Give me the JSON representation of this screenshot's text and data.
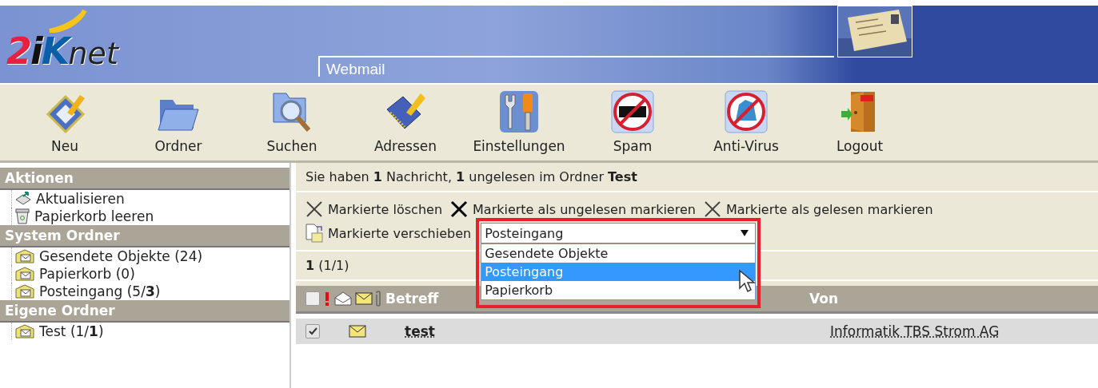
{
  "header": {
    "logo": [
      {
        "text": "2",
        "color": "#e8203f"
      },
      {
        "text": "i",
        "color": "#111111"
      },
      {
        "text": "K",
        "color": "#0a5fa8"
      },
      {
        "text": "net",
        "color": "#222222"
      }
    ],
    "tab": "Webmail"
  },
  "toolbar": [
    {
      "label": "Neu",
      "kind": "new"
    },
    {
      "label": "Ordner",
      "kind": "folder"
    },
    {
      "label": "Suchen",
      "kind": "search"
    },
    {
      "label": "Adressen",
      "kind": "addresses"
    },
    {
      "label": "Einstellungen",
      "kind": "settings"
    },
    {
      "label": "Spam",
      "kind": "spam"
    },
    {
      "label": "Anti-Virus",
      "kind": "antivirus"
    },
    {
      "label": "Logout",
      "kind": "logout"
    }
  ],
  "sidebar": [
    {
      "title": "Aktionen",
      "items": [
        {
          "label": "Aktualisieren",
          "kind": "refresh"
        },
        {
          "label": "Papierkorb leeren",
          "kind": "trash"
        }
      ]
    },
    {
      "title": "System Ordner",
      "items": [
        {
          "label": "Gesendete Objekte (24)",
          "kind": "folder"
        },
        {
          "label": "Papierkorb (0)",
          "kind": "folder"
        },
        {
          "label": "Posteingang (5/**3**)",
          "kind": "folder"
        }
      ]
    },
    {
      "title": "Eigene Ordner",
      "items": [
        {
          "label": "Test (1/**1**)",
          "kind": "folder"
        }
      ]
    }
  ],
  "info": "Sie haben **1** Nachricht, **1** ungelesen im Ordner **Test**",
  "actions": [
    {
      "label": "Markierte löschen",
      "kind": "cross-light"
    },
    {
      "label": "Markierte als ungelesen markieren",
      "kind": "cross-dark"
    },
    {
      "label": "Markierte als gelesen markieren",
      "kind": "cross-light"
    }
  ],
  "move": {
    "label": "Markierte verschieben",
    "value": "Posteingang",
    "options": [
      {
        "label": "Gesendete Objekte",
        "selected": false
      },
      {
        "label": "Posteingang",
        "selected": true
      },
      {
        "label": "Papierkorb",
        "selected": false
      }
    ]
  },
  "count": "**1** (1/1)",
  "table": {
    "select_all": false,
    "columns": [
      "Betreff",
      "Von"
    ],
    "rows": [
      {
        "checked": true,
        "unread": true,
        "subject": "test",
        "from": "Informatik TBS Strom AG"
      }
    ]
  }
}
